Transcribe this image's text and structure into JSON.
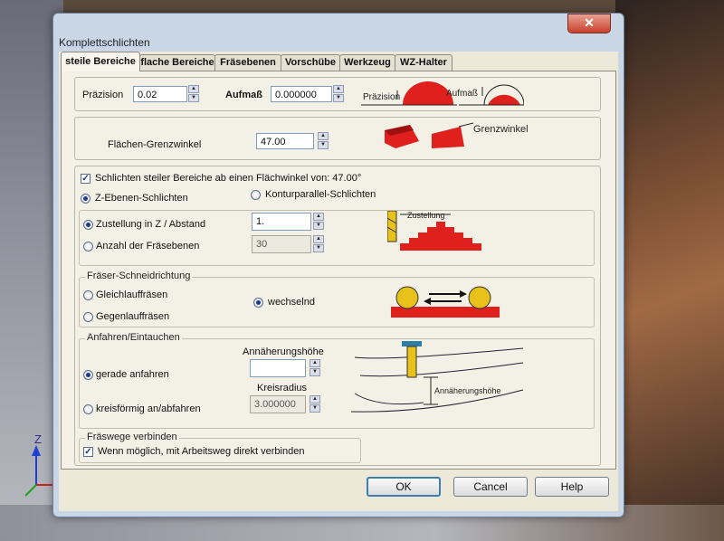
{
  "window": {
    "title": "Komplettschlichten",
    "close_glyph": "✕"
  },
  "tabs": [
    {
      "label": "steile Bereiche",
      "active": true
    },
    {
      "label": "flache Bereiche",
      "active": false
    },
    {
      "label": "Fräsebenen",
      "active": false
    },
    {
      "label": "Vorschübe",
      "active": false
    },
    {
      "label": "Werkzeug",
      "active": false
    },
    {
      "label": "WZ-Halter",
      "active": false
    }
  ],
  "precision": {
    "label": "Präzision",
    "value": "0.02",
    "allowance_label": "Aufmaß",
    "allowance_value": "0.000000",
    "illus_precision": "Präzision",
    "illus_allowance": "Aufmaß"
  },
  "limit_angle": {
    "label": "Flächen-Grenzwinkel",
    "value": "47.00",
    "illus_label": "Grenzwinkel"
  },
  "steep": {
    "checkbox_label": "Schlichten steiler Bereiche ab einen Flächwinkel von: 47.00°",
    "checked": true,
    "radio_z": "Z-Ebenen-Schlichten",
    "radio_contour": "Konturparallel-Schlichten",
    "selected": "z"
  },
  "stepdown": {
    "radio_step": "Zustellung in Z / Abstand",
    "step_value": "1.",
    "radio_count": "Anzahl der Fräsebenen",
    "count_value": "30",
    "selected": "step",
    "illus_label": "Zustellung"
  },
  "cutting_dir": {
    "legend": "Fräser-Schneidrichtung",
    "climb": "Gleichlauffräsen",
    "conventional": "Gegenlauffräsen",
    "alternate": "wechselnd",
    "selected": "alternate"
  },
  "approach": {
    "legend": "Anfahren/Eintauchen",
    "height_label": "Annäherungshöhe",
    "height_value": "",
    "straight": "gerade anfahren",
    "circular": "kreisförmig an/abfahren",
    "radius_label": "Kreisradius",
    "radius_value": "3.000000",
    "selected": "straight",
    "illus_label": "Annäherungshöhe"
  },
  "connect": {
    "legend": "Fräswege verbinden",
    "checkbox_label": "Wenn möglich, mit  Arbeitsweg direkt verbinden",
    "checked": true
  },
  "buttons": {
    "ok": "OK",
    "cancel": "Cancel",
    "help": "Help"
  },
  "background": {
    "axis_label": "Z"
  },
  "colors": {
    "accent_red": "#e0201c",
    "tool_yellow": "#e8c21a",
    "window_frame": "#c9d6e6"
  }
}
